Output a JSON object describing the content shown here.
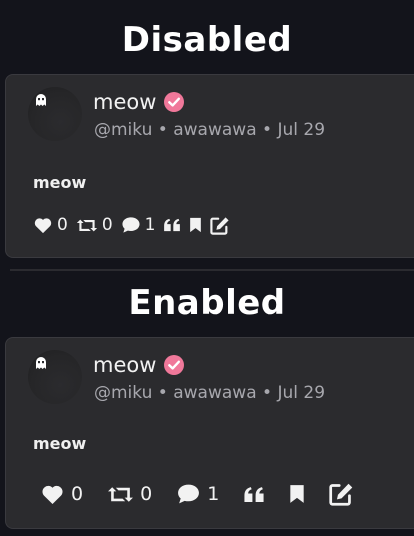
{
  "sections": [
    {
      "heading": "Disabled",
      "post": {
        "display_name": "meow",
        "handle": "@miku",
        "instance": "awawawa",
        "date": "Jul 29",
        "separator": "•",
        "body": "meow",
        "likes": "0",
        "reposts": "0",
        "replies": "1"
      }
    },
    {
      "heading": "Enabled",
      "post": {
        "display_name": "meow",
        "handle": "@miku",
        "instance": "awawawa",
        "date": "Jul 29",
        "separator": "•",
        "body": "meow",
        "likes": "0",
        "reposts": "0",
        "replies": "1"
      }
    }
  ],
  "colors": {
    "background": "#13141b",
    "card": "#2b2b2e",
    "verified_badge": "#f0789a",
    "muted_text": "#a7a7ad"
  },
  "icons": [
    "heart-icon",
    "repost-icon",
    "comment-icon",
    "quote-icon",
    "bookmark-icon",
    "edit-icon",
    "verified-badge-icon",
    "ghost-icon"
  ]
}
